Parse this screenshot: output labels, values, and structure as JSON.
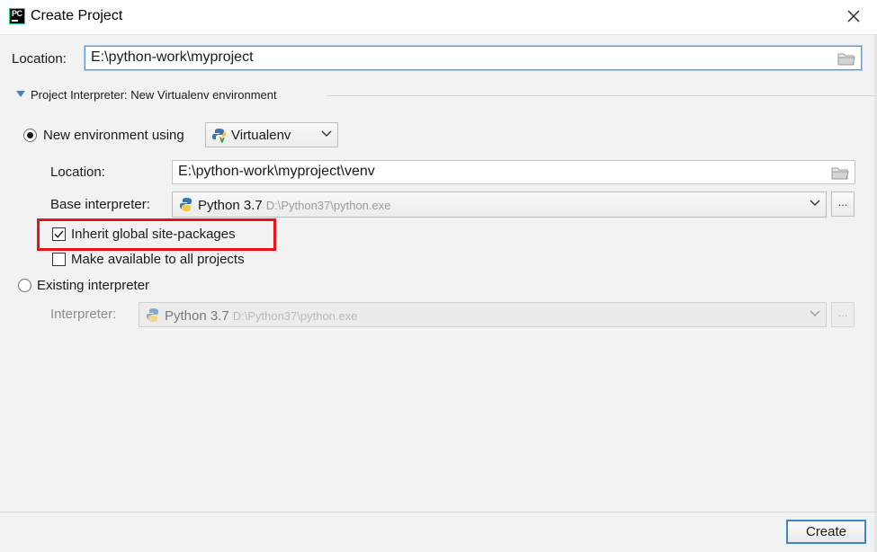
{
  "window": {
    "title": "Create Project",
    "app_icon_text": "PC"
  },
  "location": {
    "label": "Location:",
    "value": "E:\\python-work\\myproject"
  },
  "section": {
    "title": "Project Interpreter: New Virtualenv environment",
    "expanded": true
  },
  "new_env": {
    "label": "New environment using",
    "selected": true,
    "tool": "Virtualenv",
    "location_label": "Location:",
    "location_value": "E:\\python-work\\myproject\\venv",
    "base_interpreter_label": "Base interpreter:",
    "base_interpreter_name": "Python 3.7",
    "base_interpreter_path": "D:\\Python37\\python.exe",
    "browse_label": "...",
    "inherit_label": "Inherit global site-packages",
    "inherit_checked": true,
    "available_label": "Make available to all projects",
    "available_checked": false
  },
  "existing": {
    "label": "Existing interpreter",
    "selected": false,
    "interpreter_label": "Interpreter:",
    "interpreter_name": "Python 3.7",
    "interpreter_path": "D:\\Python37\\python.exe",
    "browse_label": "..."
  },
  "footer": {
    "create_label": "Create"
  },
  "colors": {
    "accent": "#3d86c8",
    "highlight": "#e8131a",
    "background": "#f2f2f2"
  },
  "icons": [
    "pycharm-icon",
    "close-icon",
    "folder-icon",
    "expand-triangle-icon",
    "python-icon",
    "chevron-down-icon",
    "check-icon"
  ]
}
